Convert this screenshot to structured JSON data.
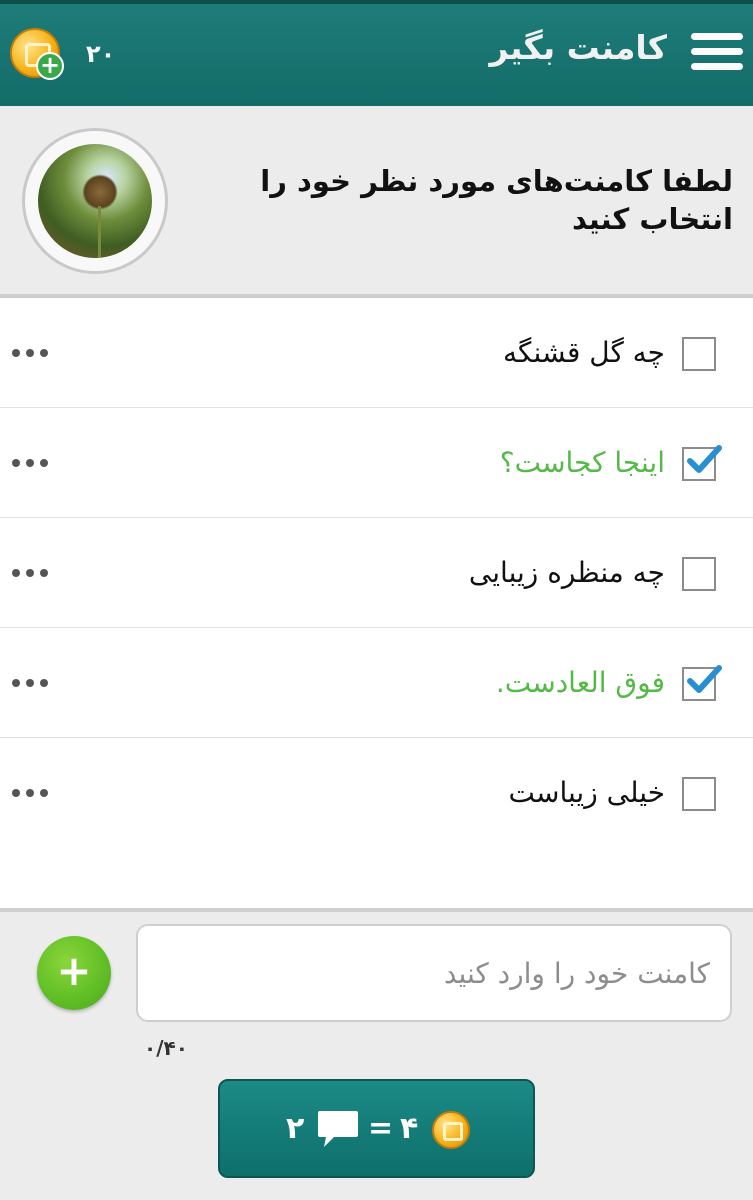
{
  "header": {
    "title": "کامنت بگیر",
    "coins": "۲۰",
    "menu_icon": "hamburger-menu-icon",
    "coin_icon": "coin-add-icon"
  },
  "post": {
    "prompt": "لطفا کامنت‌های مورد نظر خود را انتخاب کنید"
  },
  "comments": [
    {
      "text": "چه گل قشنگه",
      "checked": false
    },
    {
      "text": "اینجا کجاست؟",
      "checked": true
    },
    {
      "text": "چه منظره زیبایی",
      "checked": false
    },
    {
      "text": "فوق العادست.",
      "checked": true
    },
    {
      "text": "خیلی زیباست",
      "checked": false
    }
  ],
  "composer": {
    "placeholder": "کامنت خود را وارد کنید",
    "char_count": "۰/۴۰"
  },
  "submit": {
    "comment_count": "۲",
    "equals": "=",
    "cost": "۴"
  },
  "colors": {
    "header": "#136c68",
    "checked_text": "#55b948",
    "add_button": "#5fbd25",
    "check_mark": "#2a8fd0"
  }
}
